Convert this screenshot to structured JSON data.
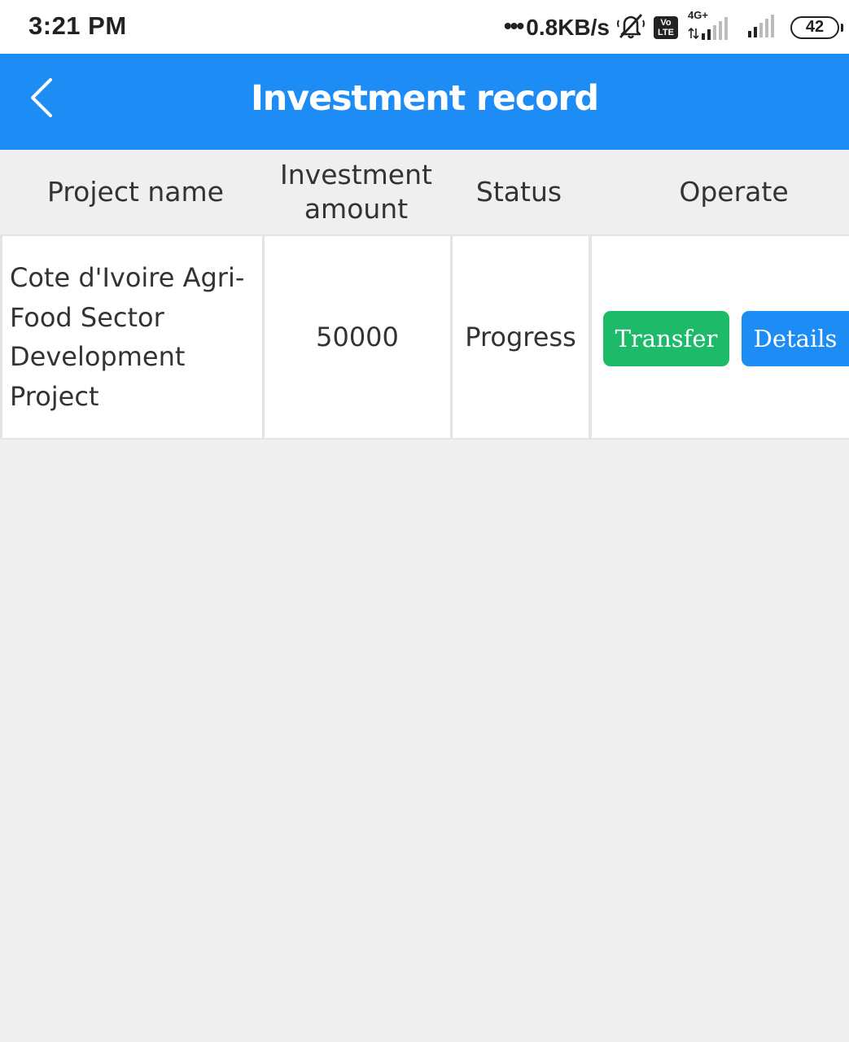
{
  "status_bar": {
    "time": "3:21 PM",
    "dots": "•••",
    "network_speed": "0.8KB/s",
    "icons": [
      "bell-muted-icon",
      "volte-icon",
      "signal-4g-icon",
      "signal-icon",
      "battery-icon"
    ],
    "volte_label_top": "Vo",
    "volte_label_bottom": "LTE",
    "network_type": "4G+",
    "battery_level": "42"
  },
  "header": {
    "back_icon": "chevron-left-icon",
    "title": "Investment record",
    "color": "#1e8cf5"
  },
  "table": {
    "columns": {
      "project_name": "Project name",
      "investment_amount": "Investment amount",
      "status": "Status",
      "operate": "Operate"
    },
    "rows": [
      {
        "project_name": "Cote d'Ivoire Agri-Food Sector Development Project",
        "investment_amount": "50000",
        "status": "Progress",
        "transfer_label": "Transfer",
        "details_label": "Details"
      }
    ]
  },
  "colors": {
    "transfer_button": "#1dba6a",
    "details_button": "#1e8cf5",
    "background": "#efefef"
  }
}
